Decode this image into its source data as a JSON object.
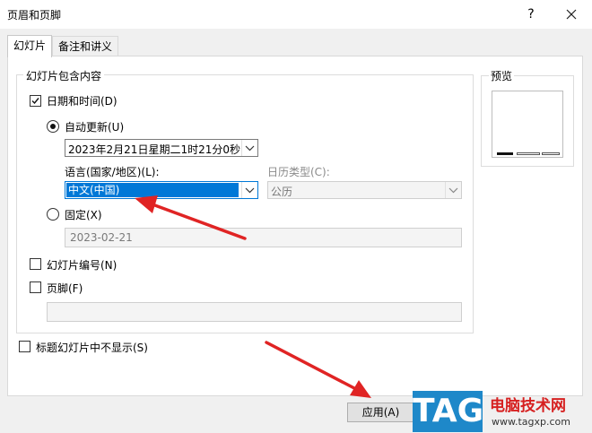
{
  "dialog": {
    "title": "页眉和页脚",
    "help": "?"
  },
  "tabs": [
    {
      "label": "幻灯片",
      "active": true
    },
    {
      "label": "备注和讲义",
      "active": false
    }
  ],
  "group": {
    "legend": "幻灯片包含内容"
  },
  "date_time": {
    "label": "日期和时间(D)",
    "checked": true,
    "auto_update": {
      "label": "自动更新(U)",
      "selected": true,
      "value": "2023年2月21日星期二1时21分0秒"
    },
    "language": {
      "label": "语言(国家/地区)(L):",
      "value": "中文(中国)"
    },
    "calendar": {
      "label": "日历类型(C):",
      "value": "公历"
    },
    "fixed": {
      "label": "固定(X)",
      "selected": false,
      "value": "2023-02-21"
    }
  },
  "slide_number": {
    "label": "幻灯片编号(N)",
    "checked": false
  },
  "footer": {
    "label": "页脚(F)",
    "checked": false,
    "value": ""
  },
  "dont_show_title": {
    "label": "标题幻灯片中不显示(S)",
    "checked": false
  },
  "preview": {
    "label": "预览"
  },
  "buttons": {
    "apply": "应用(A)"
  },
  "watermark": {
    "tag": "TAG",
    "site_name": "电脑技术网",
    "url": "www.tagxp.com"
  },
  "colors": {
    "accent": "#0078d7",
    "arrow": "#e02424"
  }
}
